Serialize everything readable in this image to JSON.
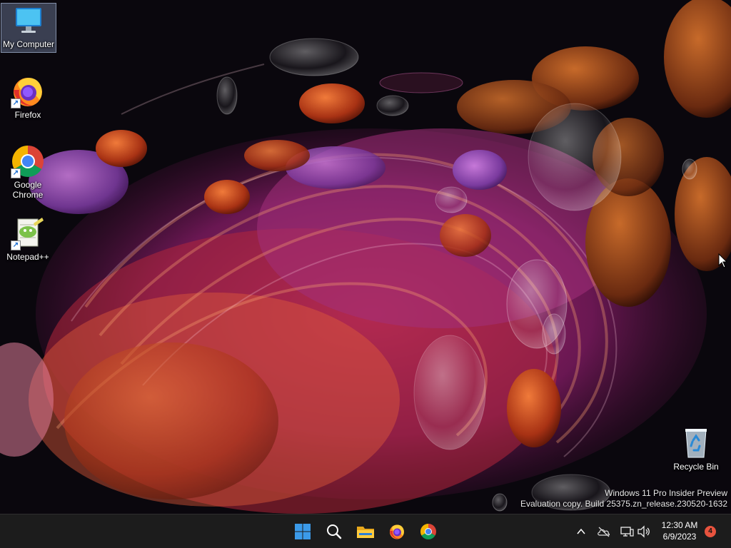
{
  "desktop": {
    "icons": [
      {
        "label": "My Computer",
        "icon": "computer-icon"
      },
      {
        "label": "Firefox",
        "icon": "firefox-icon"
      },
      {
        "label": "Google Chrome",
        "icon": "chrome-icon"
      },
      {
        "label": "Notepad++",
        "icon": "notepadpp-icon"
      },
      {
        "label": "Recycle Bin",
        "icon": "recycle-bin-icon"
      }
    ],
    "watermark": {
      "line1": "Windows 11 Pro Insider Preview",
      "line2": "Evaluation copy. Build 25375.zn_release.230520-1632"
    }
  },
  "taskbar": {
    "pinned": [
      "start-icon",
      "search-icon",
      "file-explorer-icon",
      "firefox-icon",
      "chrome-icon"
    ],
    "tray": [
      "show-hidden-icons-chevron",
      "onedrive-offline-icon",
      "network-icon",
      "volume-icon"
    ],
    "clock": {
      "time": "12:30 AM",
      "date": "6/9/2023"
    },
    "notification_count": "4"
  },
  "colors": {
    "taskbar_bg": "#1c1c1c",
    "badge": "#e8533e",
    "windows_blue": "#3b9ae8"
  }
}
